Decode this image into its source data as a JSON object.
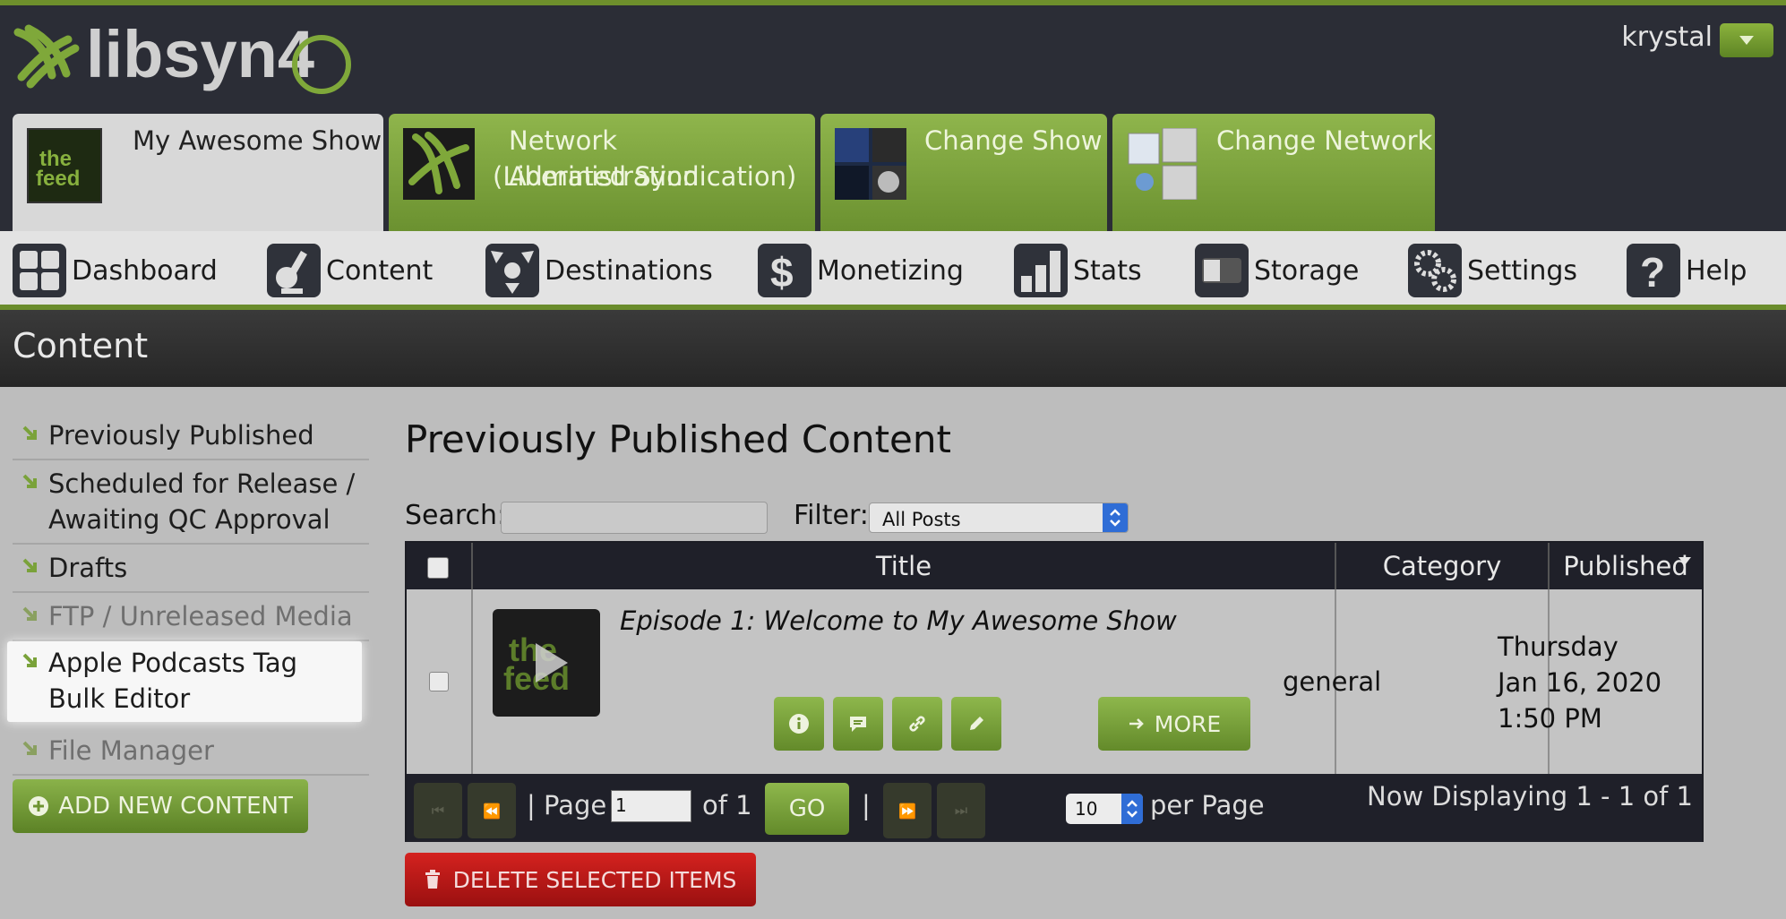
{
  "app": {
    "brand": "libsyn4",
    "user": "krystal"
  },
  "show_tabs": [
    {
      "label": "My Awesome Show"
    },
    {
      "label_line1": "Network Administration",
      "label_line2": "(Liberated Syndication)"
    },
    {
      "label": "Change Show"
    },
    {
      "label": "Change Network"
    }
  ],
  "nav": [
    {
      "label": "Dashboard",
      "icon": "dashboard-icon"
    },
    {
      "label": "Content",
      "icon": "content-icon"
    },
    {
      "label": "Destinations",
      "icon": "destinations-icon"
    },
    {
      "label": "Monetizing",
      "icon": "dollar-icon"
    },
    {
      "label": "Stats",
      "icon": "stats-icon"
    },
    {
      "label": "Storage",
      "icon": "storage-icon"
    },
    {
      "label": "Settings",
      "icon": "gears-icon"
    },
    {
      "label": "Help",
      "icon": "question-icon"
    }
  ],
  "section_title": "Content",
  "sidebar": {
    "items": [
      {
        "label": "Previously Published"
      },
      {
        "label": "Scheduled for Release / Awaiting QC Approval"
      },
      {
        "label": "Drafts"
      },
      {
        "label": "FTP / Unreleased Media"
      },
      {
        "label": "Apple Podcasts Tag Bulk Editor"
      },
      {
        "label": "File Manager"
      }
    ],
    "add_button": "ADD NEW CONTENT"
  },
  "main": {
    "title": "Previously Published Content",
    "search_label": "Search:",
    "search_value": "",
    "filter_label": "Filter:",
    "filter_value": "All Posts"
  },
  "table": {
    "columns": {
      "title": "Title",
      "category": "Category",
      "published": "Published"
    },
    "rows": [
      {
        "title": "Episode 1: Welcome to My Awesome Show",
        "category": "general",
        "published_day": "Thursday",
        "published_date": "Jan 16, 2020",
        "published_time": "1:50 PM",
        "more_label": "MORE"
      }
    ]
  },
  "pager": {
    "page_label": "| Page",
    "page_value": "1",
    "of_label": "of 1",
    "go_label": "GO",
    "sep": "|",
    "per_page_value": "10",
    "per_page_label": "per Page",
    "display_text": "Now Displaying 1 - 1 of 1"
  },
  "delete_button": "DELETE SELECTED ITEMS",
  "colors": {
    "accent": "#7aa23a",
    "dark": "#1f2029",
    "danger": "#b81a18"
  }
}
